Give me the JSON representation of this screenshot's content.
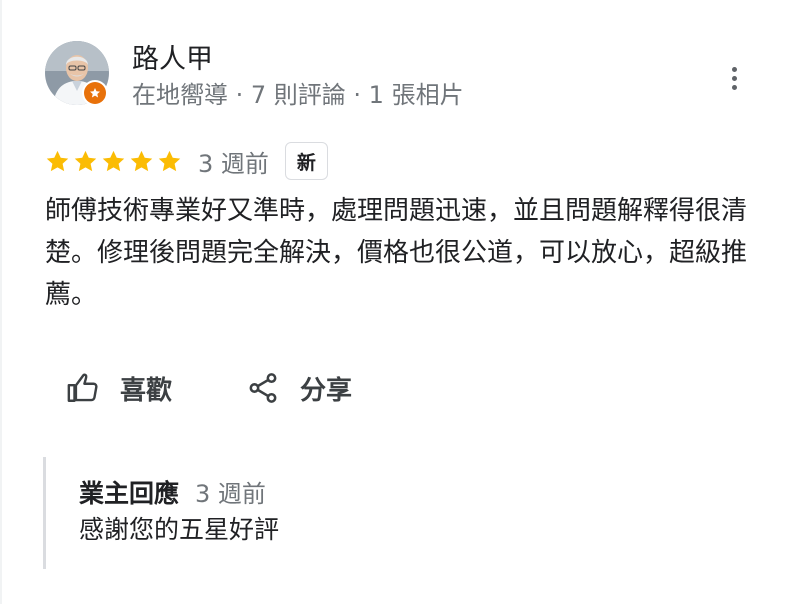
{
  "reviewer": {
    "name": "路人甲",
    "meta": "在地嚮導 · 7 則評論 · 1 張相片"
  },
  "review": {
    "rating": 5,
    "max_rating": 5,
    "time_ago": "3 週前",
    "badge": "新",
    "text": "師傅技術專業好又準時，處理問題迅速，並且問題解釋得很清楚。修理後問題完全解決，價格也很公道，可以放心，超級推薦。"
  },
  "actions": {
    "like_label": "喜歡",
    "share_label": "分享"
  },
  "owner_response": {
    "title": "業主回應",
    "time_ago": "3 週前",
    "text": "感謝您的五星好評"
  },
  "icons": {
    "avatar": "reviewer-avatar",
    "badge": "local-guide-badge-icon",
    "more": "more-vert-icon",
    "star": "star-icon",
    "like": "thumbs-up-icon",
    "share": "share-icon"
  },
  "colors": {
    "star": "#fbbc04",
    "guide_badge": "#e8710a",
    "secondary_text": "#70757a",
    "reply_border": "#dadce0"
  }
}
